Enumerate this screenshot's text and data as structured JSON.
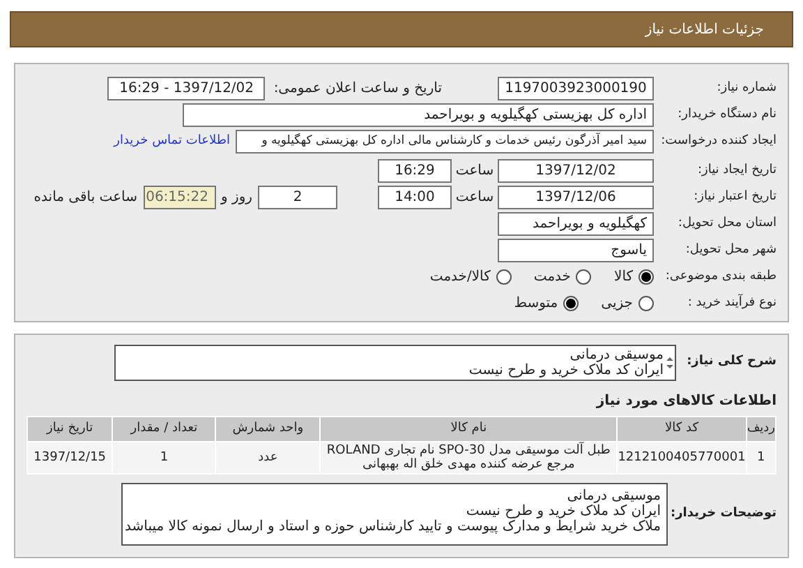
{
  "header": {
    "title": "جزئیات اطلاعات نیاز"
  },
  "need_number": {
    "label": "شماره نیاز:",
    "value": "1197003923000190"
  },
  "announce": {
    "label": "تاریخ و ساعت اعلان عمومی:",
    "value": "1397/12/02 - 16:29"
  },
  "buyer_org": {
    "label": "نام دستگاه خریدار:",
    "value": "اداره کل بهزیستی کهگیلویه و بویراحمد"
  },
  "requester": {
    "label": "ایجاد کننده درخواست:",
    "value": "سید امیر آذرگون رئیس خدمات و کارشناس مالی اداره کل بهزیستی کهگیلویه و",
    "link": "اطلاعات تماس خریدار"
  },
  "created": {
    "label": "تاریخ ایجاد نیاز:",
    "date": "1397/12/02",
    "time_label": "ساعت",
    "time": "16:29"
  },
  "validity": {
    "label": "تاریخ اعتبار نیاز:",
    "date": "1397/12/06",
    "time_label": "ساعت",
    "time": "14:00",
    "days": "2",
    "days_label": "روز و",
    "remaining": "06:15:22",
    "remaining_label": "ساعت باقی مانده"
  },
  "province": {
    "label": "استان محل تحویل:",
    "value": "کهگیلویه و بویراحمد"
  },
  "city": {
    "label": "شهر محل تحویل:",
    "value": "یاسوج"
  },
  "category": {
    "label": "طبقه بندی موضوعی:",
    "options": [
      {
        "label": "کالا",
        "selected": true
      },
      {
        "label": "خدمت",
        "selected": false
      },
      {
        "label": "کالا/خدمت",
        "selected": false
      }
    ]
  },
  "process": {
    "label": "نوع فرآیند خرید :",
    "options": [
      {
        "label": "جزیی",
        "selected": false
      },
      {
        "label": "متوسط",
        "selected": true
      }
    ]
  },
  "summary": {
    "label": "شرح کلی نیاز:",
    "lines": [
      "موسیقی درمانی",
      "ایران کد ملاک خرید و طرح نیست"
    ]
  },
  "goods_title": "اطلاعات کالاهای مورد نیاز",
  "table": {
    "columns": [
      "ردیف",
      "کد کالا",
      "نام کالا",
      "واحد شمارش",
      "تعداد / مقدار",
      "تاریخ نیاز"
    ],
    "rows": [
      [
        "1",
        "1212100405770001",
        "طبل آلت موسیقی مدل SPO-30 نام تجاری ROLAND مرجع عرضه کننده مهدی خلق اله بهبهانی",
        "عدد",
        "1",
        "1397/12/15"
      ]
    ]
  },
  "buyer_notes": {
    "label": "توضیحات خریدار:",
    "lines": [
      "موسیقی درمانی",
      "ایران کد ملاک خرید و طرح نیست",
      "ملاک خرید شرایط و مدارک پیوست و تایید کارشناس حوزه و استاد و ارسال نمونه کالا میباشد"
    ]
  }
}
